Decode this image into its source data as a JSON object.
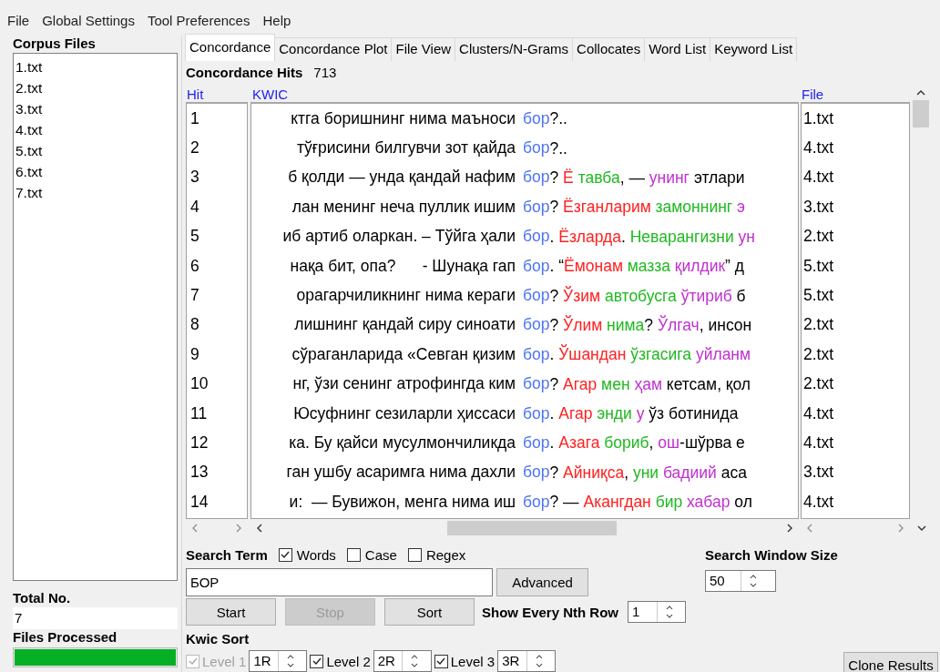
{
  "menu": [
    "File",
    "Global Settings",
    "Tool Preferences",
    "Help"
  ],
  "corpus_files": {
    "title": "Corpus Files",
    "items": [
      "1.txt",
      "2.txt",
      "3.txt",
      "4.txt",
      "5.txt",
      "6.txt",
      "7.txt"
    ]
  },
  "total_no": {
    "label": "Total No.",
    "value": "7"
  },
  "files_processed": {
    "label": "Files Processed",
    "level": 1
  },
  "tabs": [
    {
      "label": "Concordance",
      "selected": true
    },
    {
      "label": "Concordance Plot",
      "selected": false
    },
    {
      "label": "File View",
      "selected": false
    },
    {
      "label": "Clusters/N-Grams",
      "selected": false
    },
    {
      "label": "Collocates",
      "selected": false
    },
    {
      "label": "Word List",
      "selected": false
    },
    {
      "label": "Keyword List",
      "selected": false
    }
  ],
  "hits": {
    "label": "Concordance Hits",
    "value": "713"
  },
  "table": {
    "columns": [
      "Hit",
      "KWIC",
      "File"
    ],
    "rows": [
      {
        "hit": "1",
        "left": "ктга боришнинг нима маъноси",
        "keyword": "бор",
        "after": "?..",
        "file": "1.txt"
      },
      {
        "hit": "2",
        "left": "тўғрисини билгувчи зот қайда",
        "keyword": "бор",
        "after": "?..",
        "file": "4.txt"
      },
      {
        "hit": "3",
        "left": "б қолди — унда қандай нафим",
        "keyword": "бор",
        "after": "? ",
        "right": [
          {
            "text": "Ё",
            "color": "#ff2020"
          },
          {
            "text": " тавба",
            "color": "#20b820"
          },
          {
            "text": ", — "
          },
          {
            "text": "унинг",
            "color": "#c030d0"
          },
          {
            "text": " этлари"
          }
        ],
        "file": "4.txt"
      },
      {
        "hit": "4",
        "left": "лан менинг неча пуллик ишим",
        "keyword": "бор",
        "after": "? ",
        "right": [
          {
            "text": "Ёзганларим",
            "color": "#ff2020"
          },
          {
            "text": " замоннинг",
            "color": "#20b820"
          },
          {
            "text": " э",
            "color": "#c030d0"
          }
        ],
        "file": "3.txt"
      },
      {
        "hit": "5",
        "left": "иб артиб оларкан. – Тўйга ҳали",
        "keyword": "бор",
        "after": ". ",
        "right": [
          {
            "text": "Ёзларда",
            "color": "#ff2020"
          },
          {
            "text": ". "
          },
          {
            "text": "Неварангизни",
            "color": "#20b820"
          },
          {
            "text": " ун",
            "color": "#c030d0"
          }
        ],
        "file": "2.txt"
      },
      {
        "hit": "6",
        "left": "нақа бит, опа?      - Шунақа гап",
        "keyword": "бор",
        "after": ". “",
        "right": [
          {
            "text": "Ёмонам",
            "color": "#ff2020"
          },
          {
            "text": " мазза",
            "color": "#20b820"
          },
          {
            "text": " қилдик",
            "color": "#c030d0"
          },
          {
            "text": "” д"
          }
        ],
        "file": "5.txt"
      },
      {
        "hit": "7",
        "left": "орагарчиликнинг нима кераги",
        "keyword": "бор",
        "after": "? ",
        "right": [
          {
            "text": "Ўзим",
            "color": "#ff2020"
          },
          {
            "text": " автобусга",
            "color": "#20b820"
          },
          {
            "text": " ўтириб",
            "color": "#c030d0"
          },
          {
            "text": " б"
          }
        ],
        "file": "5.txt"
      },
      {
        "hit": "8",
        "left": "лишнинг қандай сиру синоати",
        "keyword": "бор",
        "after": "? ",
        "right": [
          {
            "text": "Ўлим",
            "color": "#ff2020"
          },
          {
            "text": " нима",
            "color": "#20b820"
          },
          {
            "text": "? "
          },
          {
            "text": "Ўлгач",
            "color": "#c030d0"
          },
          {
            "text": ", инсон"
          }
        ],
        "file": "2.txt"
      },
      {
        "hit": "9",
        "left": "сўраганларида «Севган қизим",
        "keyword": "бор",
        "after": ". ",
        "right": [
          {
            "text": "Ўшандан",
            "color": "#ff2020"
          },
          {
            "text": " ўзгасига",
            "color": "#20b820"
          },
          {
            "text": " уйланм",
            "color": "#c030d0"
          }
        ],
        "file": "2.txt"
      },
      {
        "hit": "10",
        "left": "нг, ўзи сенинг атрофингда ким",
        "keyword": "бор",
        "after": "? ",
        "right": [
          {
            "text": "Агар",
            "color": "#ff2020"
          },
          {
            "text": " мен",
            "color": "#20b820"
          },
          {
            "text": " ҳам",
            "color": "#c030d0"
          },
          {
            "text": " кетсам, қол"
          }
        ],
        "file": "2.txt"
      },
      {
        "hit": "11",
        "left": "Юсуфнинг сезиларли ҳиссаси",
        "keyword": "бор",
        "after": ". ",
        "right": [
          {
            "text": "Агар",
            "color": "#ff2020"
          },
          {
            "text": " энди",
            "color": "#20b820"
          },
          {
            "text": " у",
            "color": "#c030d0"
          },
          {
            "text": " ўз ботинида"
          }
        ],
        "file": "4.txt"
      },
      {
        "hit": "12",
        "left": "ка. Бу қайси мусулмончиликда",
        "keyword": "бор",
        "after": ". ",
        "right": [
          {
            "text": "Азага",
            "color": "#ff2020"
          },
          {
            "text": " бориб",
            "color": "#20b820"
          },
          {
            "text": ", "
          },
          {
            "text": "ош",
            "color": "#c030d0"
          },
          {
            "text": "-шўрва е"
          }
        ],
        "file": "4.txt"
      },
      {
        "hit": "13",
        "left": "ган ушбу асаримга нима дахли",
        "keyword": "бор",
        "after": "? ",
        "right": [
          {
            "text": "Айниқса",
            "color": "#ff2020"
          },
          {
            "text": ", "
          },
          {
            "text": "уни",
            "color": "#20b820"
          },
          {
            "text": " бадиий",
            "color": "#c030d0"
          },
          {
            "text": " аса"
          }
        ],
        "file": "3.txt"
      },
      {
        "hit": "14",
        "left": "и:  — Бувижон, менга нима иш",
        "keyword": "бор",
        "after": "? — ",
        "right": [
          {
            "text": "Акангдан",
            "color": "#ff2020"
          },
          {
            "text": " бир",
            "color": "#20b820"
          },
          {
            "text": " хабар",
            "color": "#c030d0"
          },
          {
            "text": " ол"
          }
        ],
        "file": "4.txt"
      }
    ]
  },
  "search": {
    "label": "Search Term",
    "options": [
      {
        "label": "Words",
        "checked": true
      },
      {
        "label": "Case",
        "checked": false
      },
      {
        "label": "Regex",
        "checked": false
      }
    ],
    "value": "БОР",
    "advanced": "Advanced"
  },
  "window_size": {
    "label": "Search Window Size",
    "value": "50"
  },
  "buttons": [
    {
      "label": "Start",
      "disabled": false
    },
    {
      "label": "Stop",
      "disabled": true
    },
    {
      "label": "Sort",
      "disabled": false
    }
  ],
  "nth_row": {
    "label": "Show Every Nth Row",
    "value": "1"
  },
  "kwic_sort": {
    "label": "Kwic Sort",
    "levels": [
      {
        "label": "Level 1",
        "checked": true,
        "disabled": true,
        "value": "1R"
      },
      {
        "label": "Level 2",
        "checked": true,
        "disabled": false,
        "value": "2R"
      },
      {
        "label": "Level 3",
        "checked": true,
        "disabled": false,
        "value": "3R"
      }
    ]
  },
  "clone_button": "Clone Results"
}
